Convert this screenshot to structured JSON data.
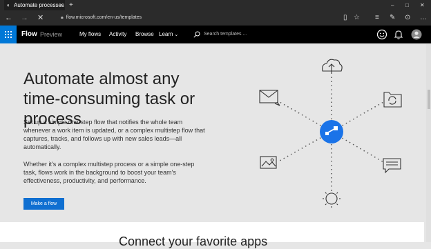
{
  "browser": {
    "tab_title": "Automate processes +",
    "tab_close": "×",
    "new_tab": "+",
    "url": "flow.microsoft.com/en-us/templates",
    "minimize": "–",
    "maximize": "□",
    "close": "✕"
  },
  "header": {
    "brand": "Flow",
    "brand_sub": "Preview",
    "nav": [
      "My flows",
      "Activity",
      "Browse",
      "Learn"
    ],
    "search_placeholder": "Search templates ..."
  },
  "hero": {
    "title": "Automate almost any time-consuming task or process",
    "p1": "Set up a simple one-step flow that notifies the whole team whenever a work item is updated, or a complex multistep flow that captures, tracks, and follows up with new sales leads—all automatically.",
    "p2": "Whether it's a complex multistep process or a simple one-step task, flows work in the background to boost your team's effectiveness, productivity, and performance.",
    "cta": "Make a flow"
  },
  "next_section": {
    "title_partial": "Connect your favorite apps"
  },
  "colors": {
    "accent": "#0078d7",
    "hub": "#1a73e8",
    "chrome": "#2b2b2b"
  },
  "icons": [
    "back-icon",
    "forward-icon",
    "stop-icon",
    "reading-view-icon",
    "favorite-icon",
    "hub-icon",
    "notes-icon",
    "share-icon",
    "waffle-icon",
    "search-icon",
    "smiley-icon",
    "bell-icon",
    "avatar-icon",
    "cloud-upload-icon",
    "mail-icon",
    "folder-sync-icon",
    "image-icon",
    "comment-icon",
    "sun-icon",
    "flow-hub-icon"
  ]
}
